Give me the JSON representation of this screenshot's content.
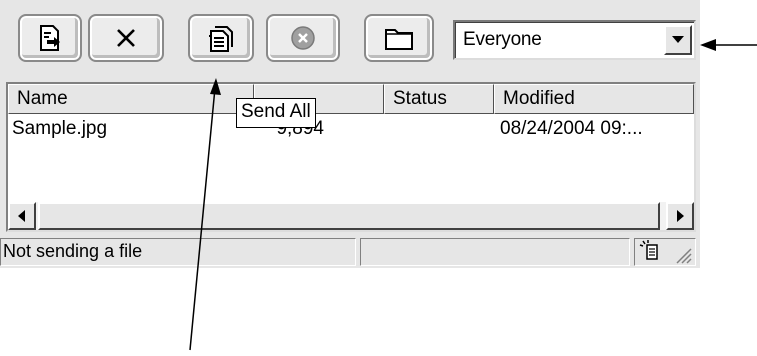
{
  "toolbar": {
    "buttons": [
      {
        "name": "send-file-button",
        "icon": "send-document-icon"
      },
      {
        "name": "delete-button",
        "icon": "x-icon"
      },
      {
        "name": "send-all-button",
        "icon": "documents-stack-icon"
      },
      {
        "name": "cancel-button",
        "icon": "cancel-circle-icon"
      },
      {
        "name": "folder-button",
        "icon": "folder-icon"
      }
    ]
  },
  "recipient_select": {
    "selected": "Everyone",
    "icon": "chevron-down-icon"
  },
  "tooltip": {
    "text": "Send All"
  },
  "file_list": {
    "columns": [
      "Name",
      "",
      "Status",
      "Modified"
    ],
    "rows": [
      {
        "name": "Sample.jpg",
        "size": "9,894",
        "status": "",
        "modified": "08/24/2004 09:..."
      }
    ]
  },
  "status_bar": {
    "text": "Not sending a file",
    "secondary": ""
  },
  "colors": {
    "chrome": "#e6e6e6",
    "border_dark": "#404040",
    "highlight": "#ffffff"
  }
}
